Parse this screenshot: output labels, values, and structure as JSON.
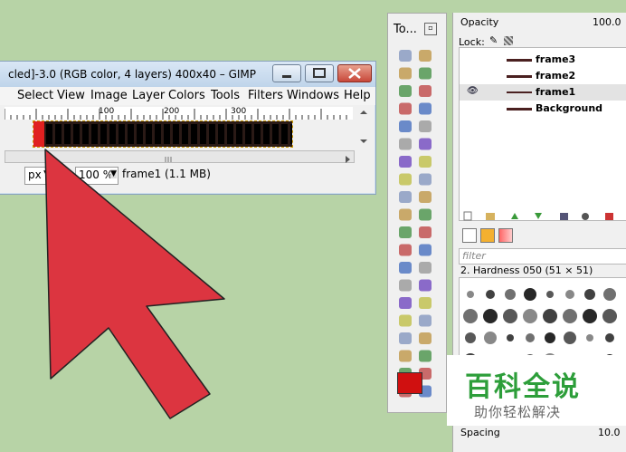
{
  "gimp_window": {
    "title": "cled]-3.0 (RGB color, 4 layers) 400x40 – GIMP",
    "menu": [
      "Select",
      "View",
      "Image",
      "Layer",
      "Colors",
      "Tools",
      "Filters",
      "Windows",
      "Help"
    ],
    "ruler_ticks": [
      "100",
      "200",
      "300"
    ],
    "status": {
      "unit": "px",
      "zoom": "100 %",
      "info": "frame1 (1.1 MB)"
    }
  },
  "toolbox": {
    "title": "To..."
  },
  "dock": {
    "opacity_label": "Opacity",
    "opacity_value": "100.0",
    "lock_label": "Lock:",
    "layers": [
      "frame3",
      "frame2",
      "frame1",
      "Background"
    ],
    "visible_layer": "frame1",
    "filter_placeholder": "filter",
    "brush_name": "2. Hardness 050 (51 × 51)",
    "spacing_label": "Spacing",
    "spacing_value": "10.0"
  },
  "watermark": {
    "line1": "百科全说",
    "line2": "助你轻松解决"
  },
  "colors": {
    "arrow": "#dc3540",
    "fg_color": "#d01010",
    "accent": "#2d9e3a"
  }
}
